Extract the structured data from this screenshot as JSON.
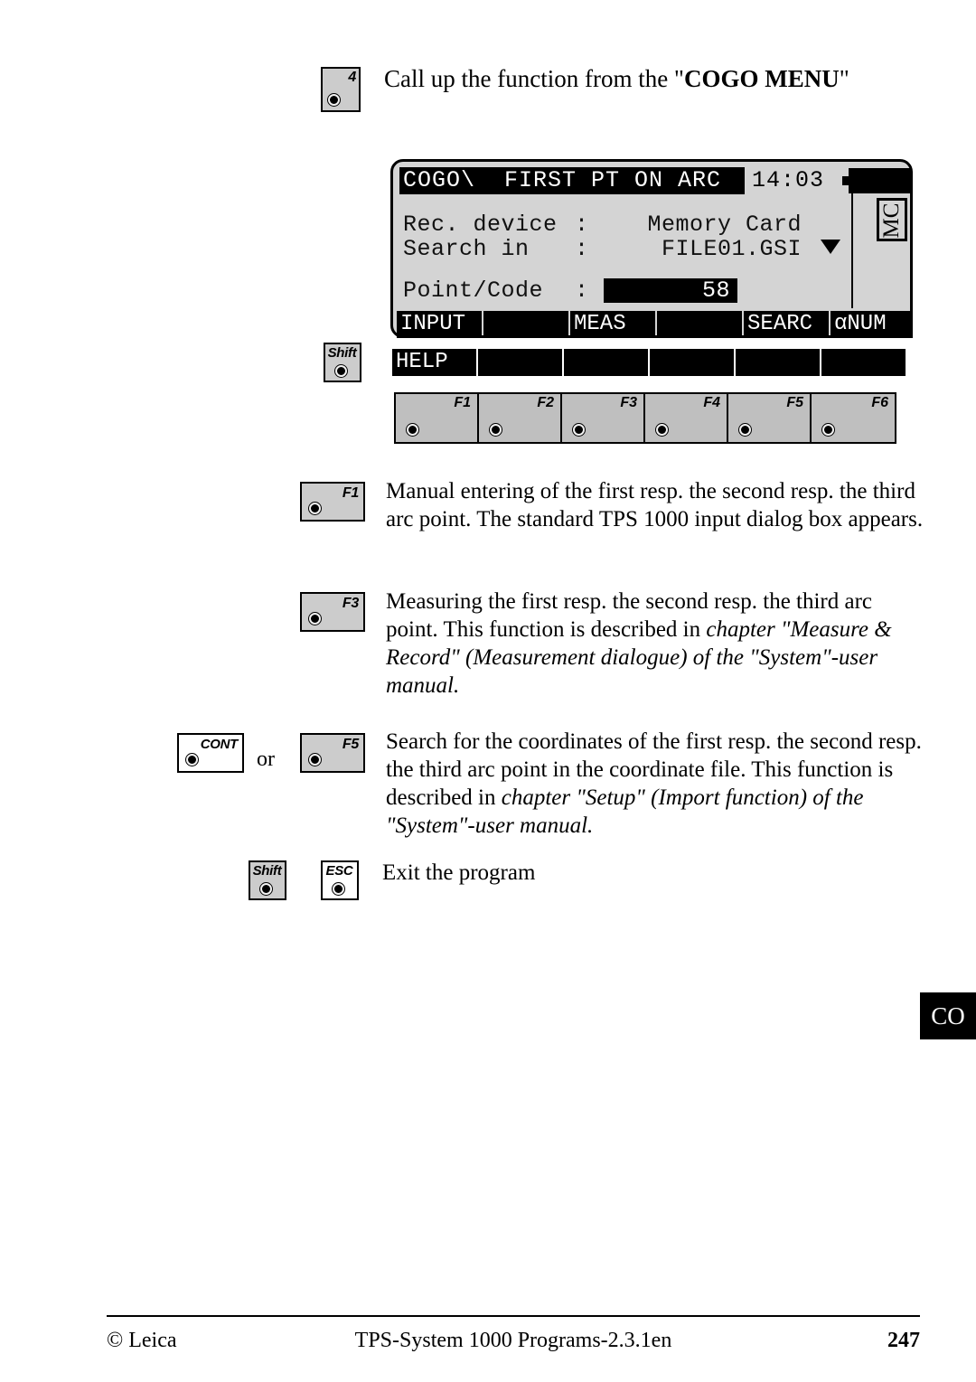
{
  "page": {
    "number": "247"
  },
  "step": {
    "key_label": "4",
    "text_prefix": "Call up the function from the \"",
    "text_bold": "COGO MENU",
    "text_suffix": "\"",
    "full_text": "Call up the function from the \"COGO MENU\""
  },
  "lcd": {
    "title": "COGO\\  FIRST PT ON ARC",
    "clock": "14:03",
    "battery_icon": "battery-full-icon",
    "card_indicator": "MC",
    "rows": [
      {
        "label": "Rec. device",
        "colon": ":",
        "value": "Memory Card",
        "highlighted": false
      },
      {
        "label": "Search in",
        "colon": ":",
        "value": "FILE01.GSI",
        "highlighted": false,
        "dropdown": true
      },
      {
        "label": "Point/Code",
        "colon": ":",
        "value": "58",
        "highlighted": true
      }
    ],
    "softkeys_row1": [
      "INPUT",
      "",
      "MEAS",
      "",
      "SEARC",
      "αNUM"
    ],
    "softkeys_row2": [
      "HELP",
      "",
      "",
      "",
      "",
      ""
    ],
    "shift_key_label": "Shift",
    "function_keys": [
      "F1",
      "F2",
      "F3",
      "F4",
      "F5",
      "F6"
    ]
  },
  "descriptions": [
    {
      "key": "F1",
      "text": "Manual entering of the first resp. the second resp. the third arc point. The standard TPS 1000 input dialog box appears."
    },
    {
      "key": "F3",
      "text_plain_1": "Measuring the first resp. the second resp. the third arc point. This function is described in ",
      "text_italic": "chapter \"Measure & Record\" (Measurement dialogue) of the \"System\"-user manual."
    },
    {
      "key_cont": "CONT",
      "conjunction": "or",
      "key_alt": "F5",
      "text_plain_1": "Search for the coordinates of the first resp. the second resp. the third arc point in the coordinate file. This function is described in ",
      "text_italic": "chapter \"Setup\" (Import function) of the \"System\"-user manual."
    },
    {
      "key_shift": "Shift",
      "key_esc": "ESC",
      "text": "Exit the program"
    }
  ],
  "side_tab": {
    "label": "CO"
  },
  "footer": {
    "left": "© Leica",
    "center": "TPS-System 1000 Programs-2.3.1en",
    "right": "247"
  }
}
